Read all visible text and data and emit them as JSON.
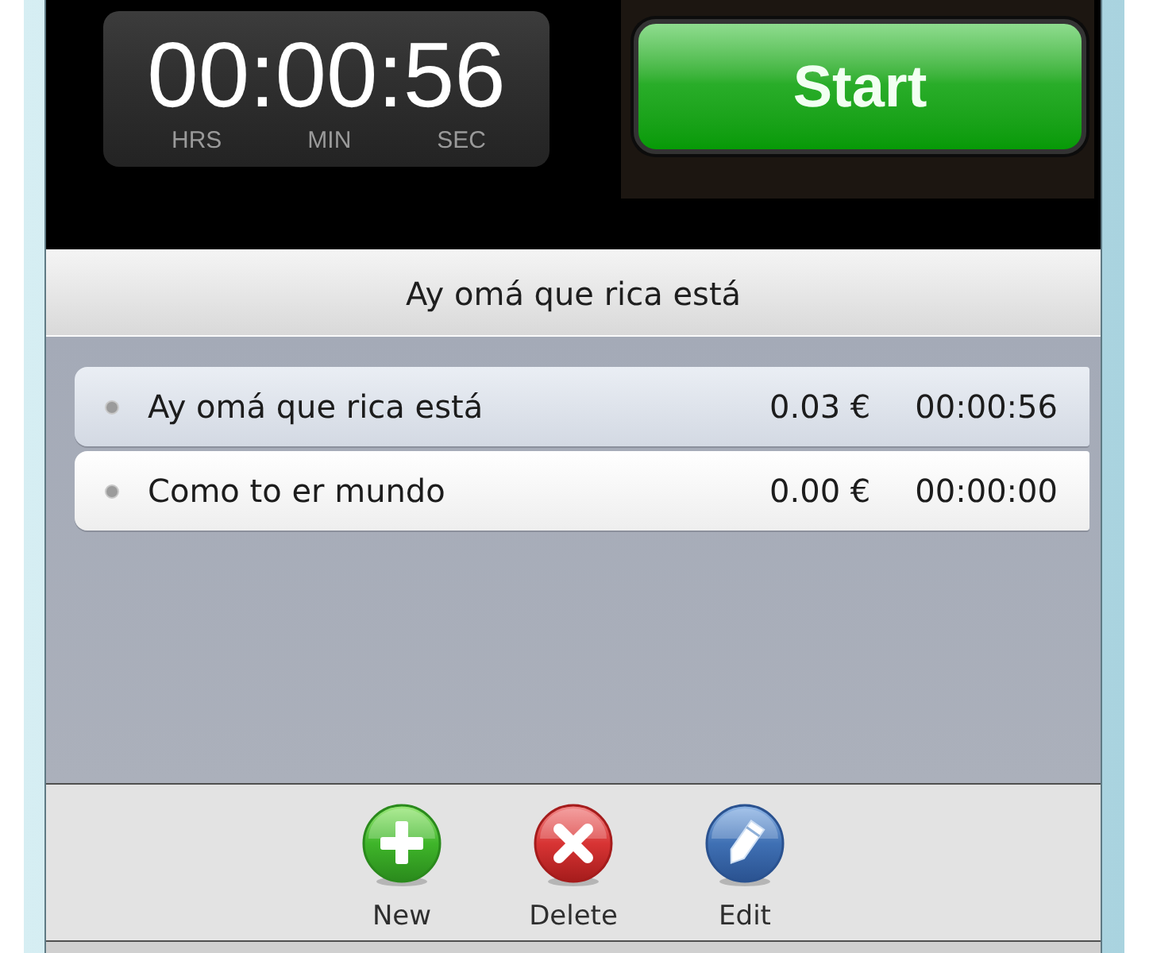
{
  "timer": {
    "display": "00:00:56",
    "units": [
      "HRS",
      "MIN",
      "SEC"
    ]
  },
  "start_button": {
    "label": "Start"
  },
  "current_task": {
    "title": "Ay omá que rica está"
  },
  "tasks": [
    {
      "name": "Ay omá que rica está",
      "cost": "0.03 €",
      "time": "00:00:56",
      "selected": true
    },
    {
      "name": "Como to er mundo",
      "cost": "0.00 €",
      "time": "00:00:00",
      "selected": false
    }
  ],
  "toolbar": [
    {
      "kind": "new",
      "label": "New"
    },
    {
      "kind": "delete",
      "label": "Delete"
    },
    {
      "kind": "edit",
      "label": "Edit"
    }
  ]
}
